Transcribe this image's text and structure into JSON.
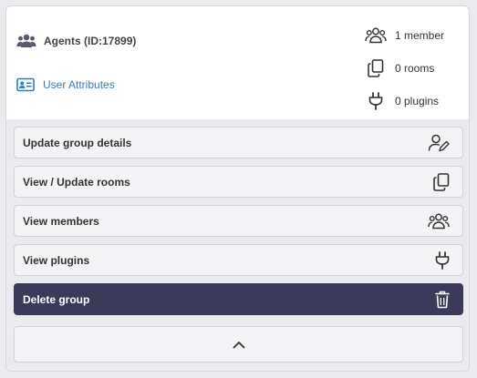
{
  "group": {
    "name": "Agents (ID:17899)",
    "attributes_link": "User Attributes"
  },
  "stats": [
    {
      "icon": "users-icon",
      "label": "1 member"
    },
    {
      "icon": "copy-icon",
      "label": "0 rooms"
    },
    {
      "icon": "plug-icon",
      "label": "0 plugins"
    }
  ],
  "actions": [
    {
      "label": "Update group details",
      "icon": "user-edit-icon"
    },
    {
      "label": "View / Update rooms",
      "icon": "copy-icon"
    },
    {
      "label": "View members",
      "icon": "users-icon"
    },
    {
      "label": "View plugins",
      "icon": "plug-icon"
    },
    {
      "label": "Delete group",
      "icon": "trash-icon"
    }
  ],
  "collapse": {
    "icon": "chevron-up-icon"
  },
  "colors": {
    "link": "#2f7fc2",
    "danger_bg": "#3b3b59",
    "card_bg": "#ebebef"
  }
}
